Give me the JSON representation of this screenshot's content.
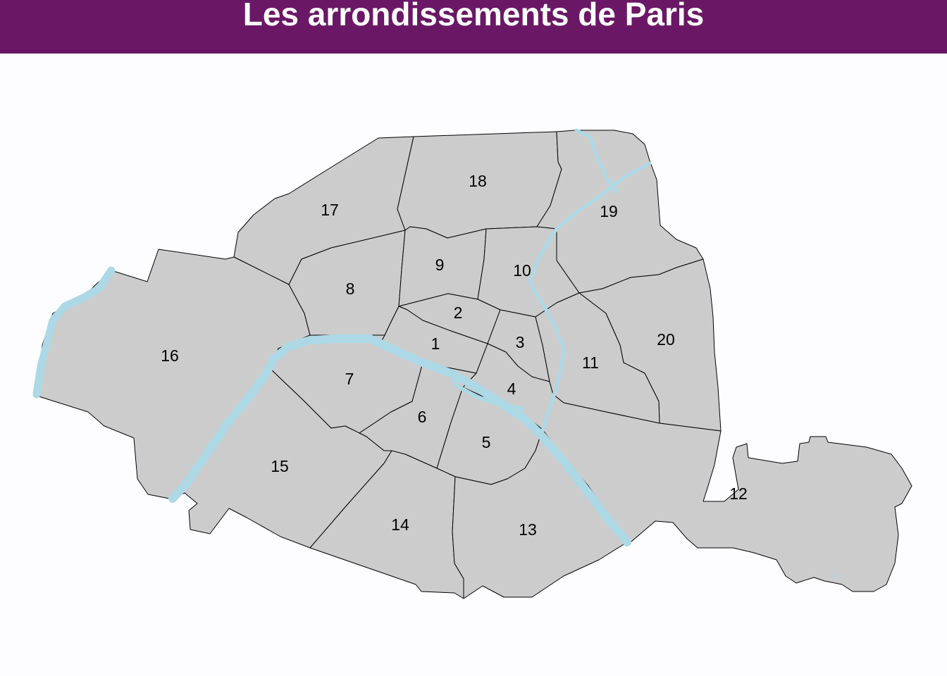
{
  "title": "Les arrondissements de Paris",
  "colors": {
    "header": "#6a1865",
    "title_text": "#ffffff",
    "land": "#cccccc",
    "water": "#add8e6",
    "border": "#000000",
    "background": "#fdfdff"
  },
  "arrondissements": [
    {
      "id": "1",
      "label": "1"
    },
    {
      "id": "2",
      "label": "2"
    },
    {
      "id": "3",
      "label": "3"
    },
    {
      "id": "4",
      "label": "4"
    },
    {
      "id": "5",
      "label": "5"
    },
    {
      "id": "6",
      "label": "6"
    },
    {
      "id": "7",
      "label": "7"
    },
    {
      "id": "8",
      "label": "8"
    },
    {
      "id": "9",
      "label": "9"
    },
    {
      "id": "10",
      "label": "10"
    },
    {
      "id": "11",
      "label": "11"
    },
    {
      "id": "12",
      "label": "12"
    },
    {
      "id": "13",
      "label": "13"
    },
    {
      "id": "14",
      "label": "14"
    },
    {
      "id": "15",
      "label": "15"
    },
    {
      "id": "16",
      "label": "16"
    },
    {
      "id": "17",
      "label": "17"
    },
    {
      "id": "18",
      "label": "18"
    },
    {
      "id": "19",
      "label": "19"
    },
    {
      "id": "20",
      "label": "20"
    }
  ]
}
